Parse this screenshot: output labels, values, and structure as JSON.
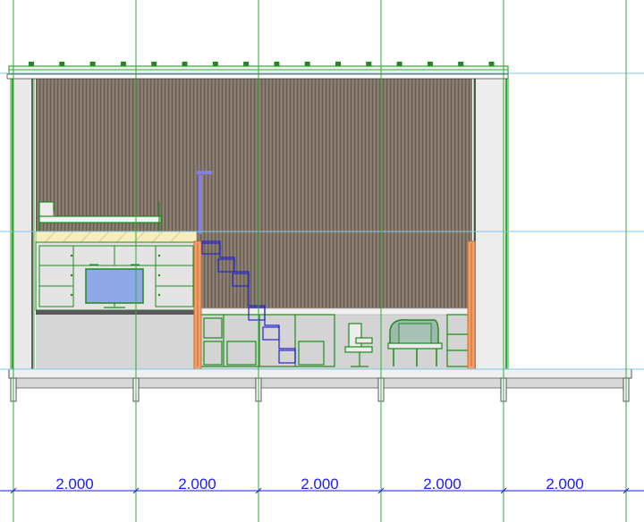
{
  "view": {
    "type": "section elevation drawing",
    "background_color": "#ffffff",
    "grid_color": "#2fae2f",
    "guide_color": "#7fc8e8",
    "dimension_color": "#1a1aff",
    "wall_color": "#85786a",
    "floor_color": "#d4d4d4",
    "timber_color": "#f0a070",
    "furniture_color": "#1f8a1f",
    "stair_color": "#2424d0",
    "screen_color": "#8ea8e8"
  },
  "dimensions": {
    "segments": [
      {
        "label": "2.000"
      },
      {
        "label": "2.000"
      },
      {
        "label": "2.000"
      },
      {
        "label": "2.000"
      },
      {
        "label": "2.000"
      }
    ]
  },
  "icons": [
    "tv-screen",
    "office-chair",
    "desk-chair",
    "loft-bed",
    "staircase"
  ]
}
